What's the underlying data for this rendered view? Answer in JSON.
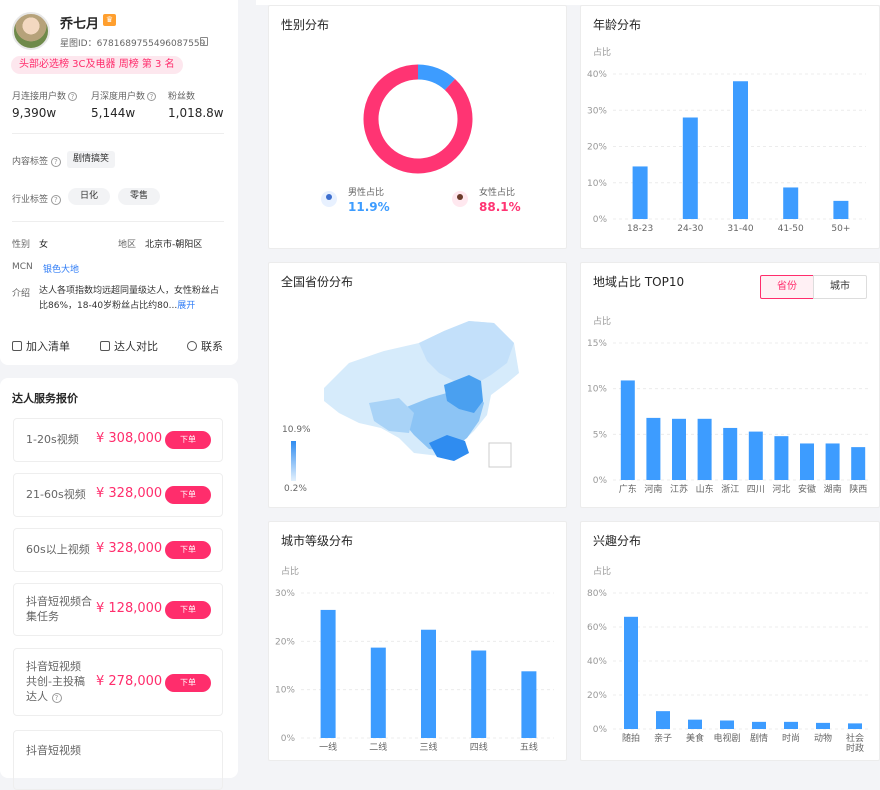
{
  "profile": {
    "name": "乔七月",
    "vip_icon": "crown-badge-icon",
    "star_id": "星图ID：6781689755496087559",
    "rank": "头部必选榜 3C及电器 周榜 第 3 名",
    "stats": [
      {
        "label": "月连接用户数",
        "value": "9,390w"
      },
      {
        "label": "月深度用户数",
        "value": "5,144w"
      },
      {
        "label": "粉丝数",
        "value": "1,018.8w"
      }
    ],
    "content_tag_label": "内容标签",
    "content_tags": [
      "剧情搞笑"
    ],
    "industry_tag_label": "行业标签",
    "industry_tags": [
      "日化",
      "零售"
    ],
    "gender_label": "性别",
    "gender": "女",
    "region_label": "地区",
    "region": "北京市-朝阳区",
    "mcn_label": "MCN",
    "mcn": "银色大地",
    "intro_label": "介绍",
    "intro": "达人各项指数均远超同量级达人，女性粉丝占比86%，18-40岁粉丝占比约80...",
    "intro_more": "展开",
    "actions": [
      "加入清单",
      "达人对比",
      "联系"
    ]
  },
  "pricing": {
    "title": "达人服务报价",
    "order_label": "下单",
    "items": [
      {
        "name": "1-20s视频",
        "price": "¥ 308,000"
      },
      {
        "name": "21-60s视频",
        "price": "¥ 328,000"
      },
      {
        "name": "60s以上视频",
        "price": "¥ 328,000"
      },
      {
        "name": "抖音短视频合集任务",
        "price": "¥ 128,000"
      },
      {
        "name": "抖音短视频共创-主投稿达人",
        "price": "¥ 278,000"
      },
      {
        "name": "抖音短视频",
        "price": ""
      }
    ]
  },
  "panels": {
    "gender_title": "性别分布",
    "age_title": "年龄分布",
    "province_title": "全国省份分布",
    "region_title": "地域占比 TOP10",
    "region_tabs": [
      "省份",
      "城市"
    ],
    "city_title": "城市等级分布",
    "interest_title": "兴趣分布",
    "map_legend_max": "10.9%",
    "map_legend_min": "0.2%",
    "male_label": "男性占比",
    "female_label": "女性占比",
    "male_value": "11.9%",
    "female_value": "88.1%"
  },
  "colors": {
    "accent": "#ff2d6c",
    "bar": "#3d9cff",
    "female": "#ff3473",
    "male": "#3d9cff"
  },
  "chart_data": [
    {
      "type": "pie",
      "title": "性别分布",
      "categories": [
        "男性占比",
        "女性占比"
      ],
      "values": [
        11.9,
        88.1
      ]
    },
    {
      "type": "bar",
      "title": "年龄分布",
      "ylabel": "占比",
      "categories": [
        "18-23",
        "24-30",
        "31-40",
        "41-50",
        "50+"
      ],
      "values": [
        14.5,
        28,
        38,
        8.7,
        5
      ],
      "ylim": [
        0,
        40
      ],
      "yticks": [
        "0%",
        "10%",
        "20%",
        "30%",
        "40%"
      ]
    },
    {
      "type": "bar",
      "title": "地域占比 TOP10",
      "ylabel": "占比",
      "categories": [
        "广东",
        "河南",
        "江苏",
        "山东",
        "浙江",
        "四川",
        "河北",
        "安徽",
        "湖南",
        "陕西"
      ],
      "values": [
        10.9,
        6.8,
        6.7,
        6.7,
        5.7,
        5.3,
        4.8,
        4.0,
        4.0,
        3.6
      ],
      "ylim": [
        0,
        15
      ],
      "yticks": [
        "0%",
        "5%",
        "10%",
        "15%"
      ]
    },
    {
      "type": "bar",
      "title": "城市等级分布",
      "ylabel": "占比",
      "categories": [
        "一线",
        "二线",
        "三线",
        "四线",
        "五线"
      ],
      "values": [
        26.5,
        18.7,
        22.4,
        18.1,
        13.8
      ],
      "ylim": [
        0,
        30
      ],
      "yticks": [
        "0%",
        "10%",
        "20%",
        "30%"
      ]
    },
    {
      "type": "bar",
      "title": "兴趣分布",
      "ylabel": "占比",
      "categories": [
        "随拍",
        "亲子",
        "美食",
        "电视剧",
        "剧情",
        "时尚",
        "动物",
        "社会时政"
      ],
      "values": [
        66,
        10.5,
        5.5,
        5,
        4.2,
        4.2,
        3.6,
        3.3
      ],
      "ylim": [
        0,
        80
      ],
      "yticks": [
        "0%",
        "20%",
        "40%",
        "60%",
        "80%"
      ]
    }
  ]
}
